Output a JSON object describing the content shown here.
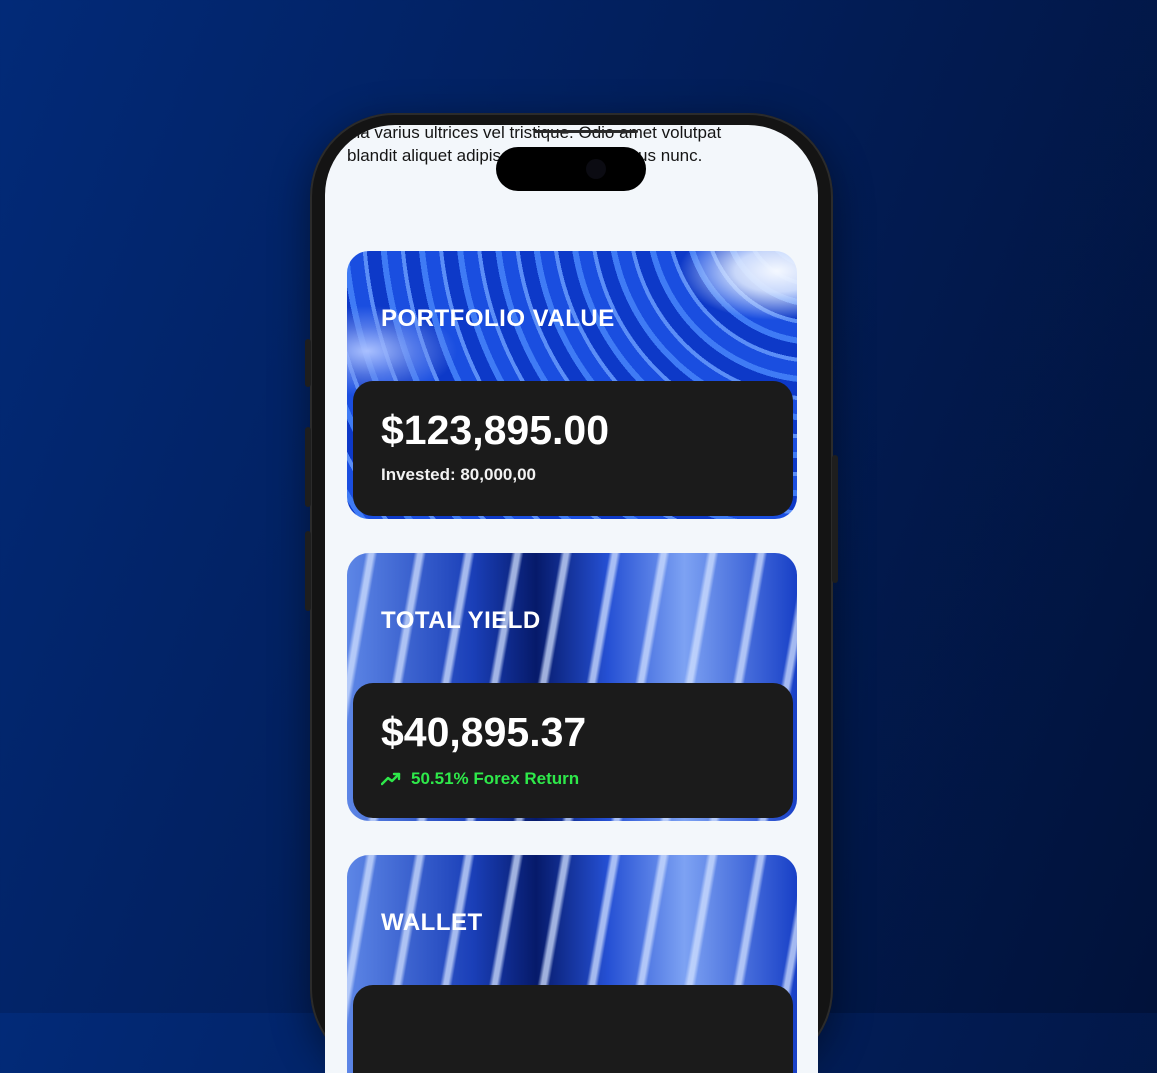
{
  "intro_text": "nla varius ultrices vel tristique. Odio amet volutpat blandit aliquet adipiscing ullam eget risus nunc.",
  "cards": {
    "portfolio": {
      "title": "PORTFOLIO VALUE",
      "amount": "$123,895.00",
      "invested": "Invested: 80,000,00"
    },
    "yield": {
      "title": "TOTAL YIELD",
      "amount": "$40,895.37",
      "return_text": "50.51% Forex Return",
      "return_icon": "trending-up-icon"
    },
    "wallet": {
      "title": "WALLET"
    }
  },
  "colors": {
    "background": "#021f5c",
    "screen": "#f3f7fb",
    "panel": "#1b1b1b",
    "positive": "#2ee84a"
  }
}
